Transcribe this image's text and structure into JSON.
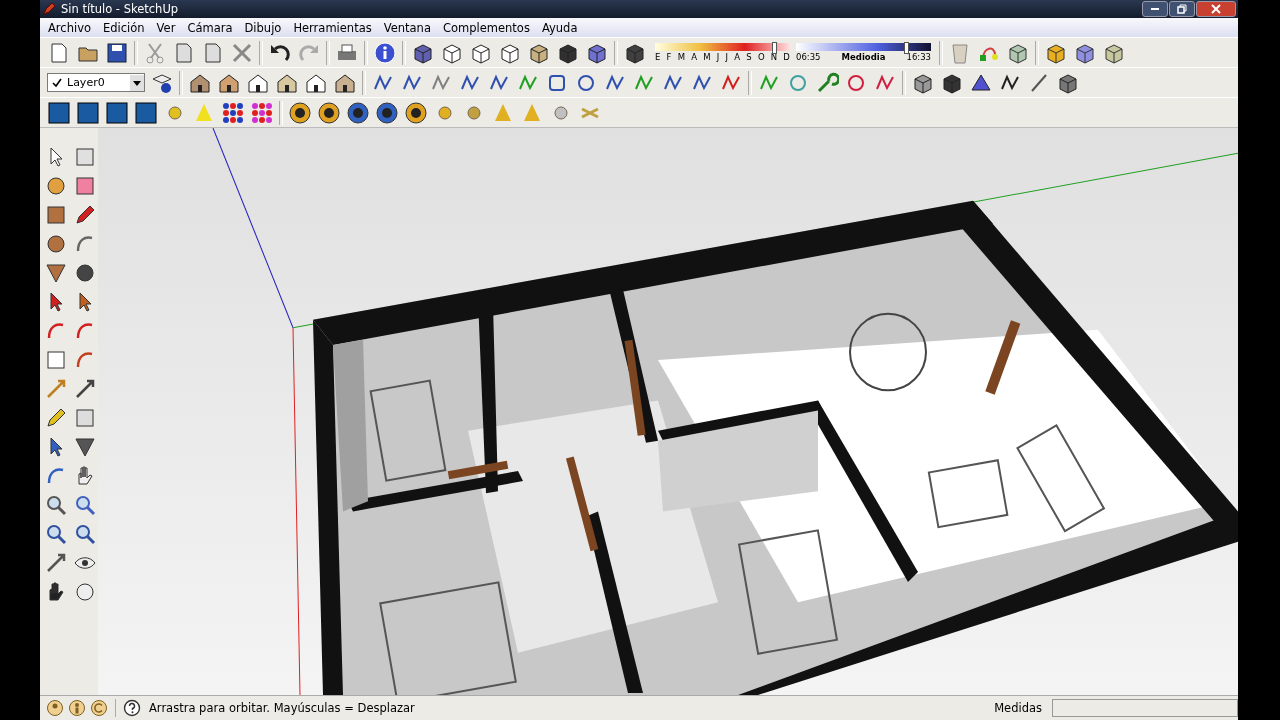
{
  "window": {
    "title": "Sin título - SketchUp"
  },
  "menu": [
    "Archivo",
    "Edición",
    "Ver",
    "Cámara",
    "Dibujo",
    "Herramientas",
    "Ventana",
    "Complementos",
    "Ayuda"
  ],
  "layer_select": {
    "value": "Layer0",
    "checked": true
  },
  "shadow_settings": {
    "months": [
      "E",
      "F",
      "M",
      "A",
      "M",
      "J",
      "J",
      "A",
      "S",
      "O",
      "N",
      "D"
    ],
    "month_slider": {
      "level": 0.87
    },
    "time_start": "06:35",
    "time_mid": "Mediodia",
    "time_end": "16:33",
    "time_slider": {
      "level": 0.8
    }
  },
  "status_bar": {
    "hint": "Arrastra para orbitar. Mayúsculas = Desplazar",
    "measurements_label": "Medidas"
  }
}
